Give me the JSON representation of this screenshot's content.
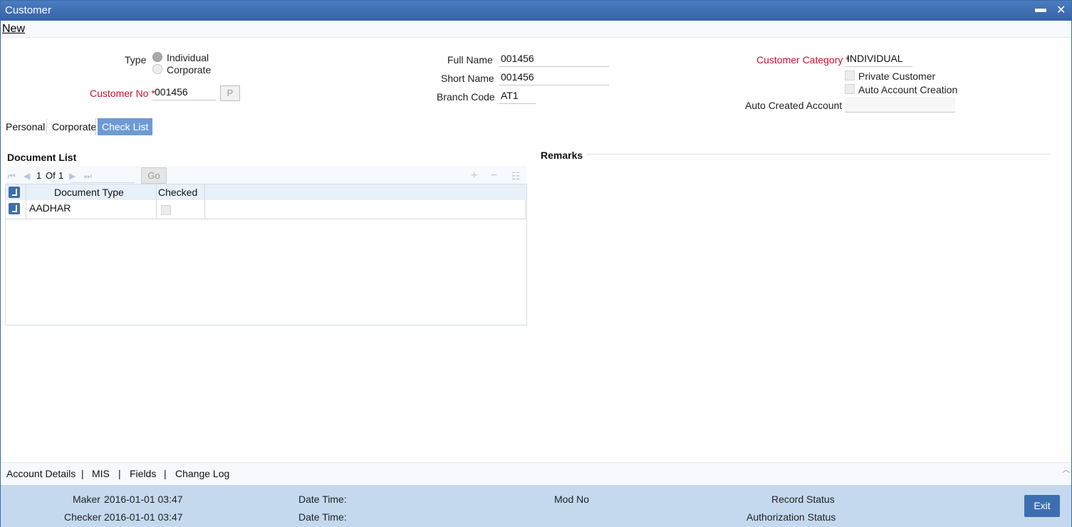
{
  "window": {
    "title": "Customer",
    "minimize": "▬",
    "close": "✕"
  },
  "menu": {
    "new": "New"
  },
  "form": {
    "type_label": "Type",
    "type_options": [
      "Individual",
      "Corporate"
    ],
    "type_selected": "Individual",
    "customer_no_label": "Customer No",
    "customer_no_value": "001456",
    "p_button": "P",
    "full_name_label": "Full Name",
    "full_name_value": "001456",
    "short_name_label": "Short Name",
    "short_name_value": "001456",
    "branch_code_label": "Branch Code",
    "branch_code_value": "AT1",
    "customer_category_label": "Customer Category",
    "customer_category_value": "INDIVIDUAL",
    "private_customer_label": "Private Customer",
    "auto_account_creation_label": "Auto Account Creation",
    "auto_created_account_label": "Auto Created Account",
    "auto_created_account_value": "",
    "required_mark": "*"
  },
  "tabs": [
    {
      "label": "Personal",
      "active": false
    },
    {
      "label": "Corporate",
      "active": false
    },
    {
      "label": "Check List",
      "active": true
    }
  ],
  "document_list": {
    "title": "Document List",
    "pager": {
      "current": "1",
      "of_label": "Of",
      "total": "1",
      "go_label": "Go"
    },
    "columns": [
      "Document Type",
      "Checked"
    ],
    "rows": [
      {
        "document_type": "AADHAR",
        "checked": false
      }
    ]
  },
  "remarks": {
    "title": "Remarks"
  },
  "footer_links": [
    "Account Details",
    "MIS",
    "Fields",
    "Change Log"
  ],
  "footer": {
    "maker_label": "Maker",
    "maker_value": "2016-01-01 03:47",
    "checker_label": "Checker",
    "checker_value": "2016-01-01 03:47",
    "date_time_label": "Date Time:",
    "mod_no_label": "Mod No",
    "record_status_label": "Record Status",
    "authorization_status_label": "Authorization Status",
    "exit_label": "Exit"
  }
}
